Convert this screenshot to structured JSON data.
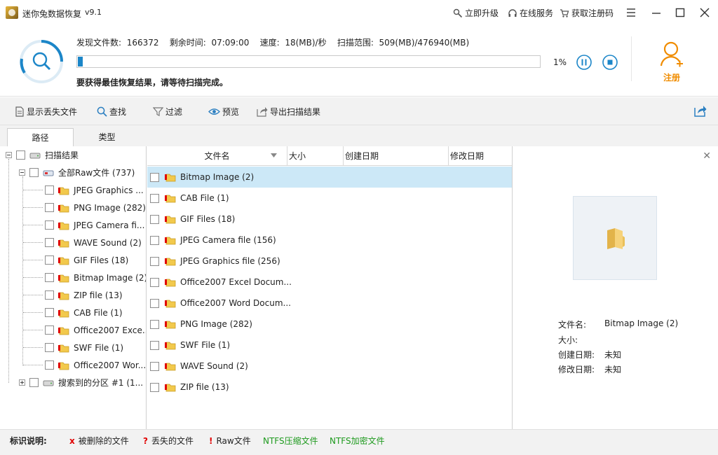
{
  "window": {
    "title": "迷你兔数据恢复",
    "version": "v9.1",
    "links": [
      {
        "label": "立即升级",
        "icon": "key-icon"
      },
      {
        "label": "在线服务",
        "icon": "headset-icon"
      },
      {
        "label": "获取注册码",
        "icon": "cart-icon"
      }
    ]
  },
  "status": {
    "found_label": "发现文件数:",
    "found_value": "166372",
    "remain_label": "剩余时间:",
    "remain_value": "07:09:00",
    "speed_label": "速度:",
    "speed_value": "18(MB)/秒",
    "range_label": "扫描范围:",
    "range_value": "509(MB)/476940(MB)",
    "progress_percent": 1,
    "percent_text": "1%",
    "tip": "要获得最佳恢复结果，请等待扫描完成。",
    "register_label": "注册"
  },
  "toolbar": {
    "show_lost": "显示丢失文件",
    "find": "查找",
    "filter": "过滤",
    "preview": "预览",
    "export": "导出扫描结果"
  },
  "tabs": {
    "path": "路径",
    "type": "类型"
  },
  "tree": {
    "root": "扫描结果",
    "raw": "全部Raw文件 (737)",
    "children": [
      "JPEG Graphics ...",
      "PNG Image (282)",
      "JPEG Camera fi...",
      "WAVE Sound (2)",
      "GIF Files (18)",
      "Bitmap Image (2)",
      "ZIP file (13)",
      "CAB File (1)",
      "Office2007 Exce...",
      "SWF File (1)",
      "Office2007 Wor..."
    ],
    "partition": "搜索到的分区 #1 (1..."
  },
  "list": {
    "columns": {
      "name": "文件名",
      "size": "大小",
      "created": "创建日期",
      "modified": "修改日期"
    },
    "rows": [
      "Bitmap Image (2)",
      "CAB File (1)",
      "GIF Files (18)",
      "JPEG Camera file (156)",
      "JPEG Graphics file (256)",
      "Office2007 Excel Docum...",
      "Office2007 Word Docum...",
      "PNG Image (282)",
      "SWF File (1)",
      "WAVE Sound (2)",
      "ZIP file (13)"
    ]
  },
  "preview": {
    "name_label": "文件名:",
    "name_value": "Bitmap Image (2)",
    "size_label": "大小:",
    "size_value": "",
    "created_label": "创建日期:",
    "created_value": "未知",
    "modified_label": "修改日期:",
    "modified_value": "未知"
  },
  "legend": {
    "title": "标识说明:",
    "deleted_mark": "x",
    "deleted": "被删除的文件",
    "lost_mark": "?",
    "lost": "丢失的文件",
    "raw_mark": "!",
    "raw": "Raw文件",
    "compressed": "NTFS压缩文件",
    "encrypted": "NTFS加密文件"
  },
  "colors": {
    "accent_blue": "#1c86c8",
    "register_orange": "#f08c00",
    "selected_row": "#cce8f7",
    "mark_red": "#e00000",
    "ntfs_green": "#1e9a1e"
  }
}
